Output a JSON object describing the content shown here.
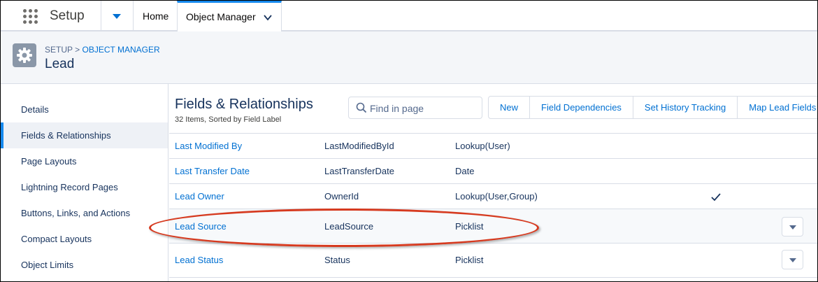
{
  "topnav": {
    "app_name": "Setup",
    "tabs": [
      {
        "label": "Home"
      },
      {
        "label": "Object Manager"
      }
    ]
  },
  "header": {
    "breadcrumb_root": "SETUP",
    "breadcrumb_sep": ">",
    "breadcrumb_link": "OBJECT MANAGER",
    "title": "Lead"
  },
  "sidebar": {
    "items": [
      {
        "label": "Details"
      },
      {
        "label": "Fields & Relationships"
      },
      {
        "label": "Page Layouts"
      },
      {
        "label": "Lightning Record Pages"
      },
      {
        "label": "Buttons, Links, and Actions"
      },
      {
        "label": "Compact Layouts"
      },
      {
        "label": "Object Limits"
      }
    ]
  },
  "main": {
    "title": "Fields & Relationships",
    "subtitle": "32 Items, Sorted by Field Label",
    "search_placeholder": "Find in page",
    "buttons": [
      {
        "label": "New"
      },
      {
        "label": "Field Dependencies"
      },
      {
        "label": "Set History Tracking"
      },
      {
        "label": "Map Lead Fields"
      }
    ],
    "rows": [
      {
        "label": "Last Modified By",
        "api": "LastModifiedById",
        "type": "Lookup(User)"
      },
      {
        "label": "Last Transfer Date",
        "api": "LastTransferDate",
        "type": "Date"
      },
      {
        "label": "Lead Owner",
        "api": "OwnerId",
        "type": "Lookup(User,Group)"
      },
      {
        "label": "Lead Source",
        "api": "LeadSource",
        "type": "Picklist"
      },
      {
        "label": "Lead Status",
        "api": "Status",
        "type": "Picklist"
      }
    ]
  },
  "colors": {
    "link": "#0070d2",
    "text": "#16325c",
    "accent": "#1589ee",
    "highlight": "#d63a1f"
  }
}
